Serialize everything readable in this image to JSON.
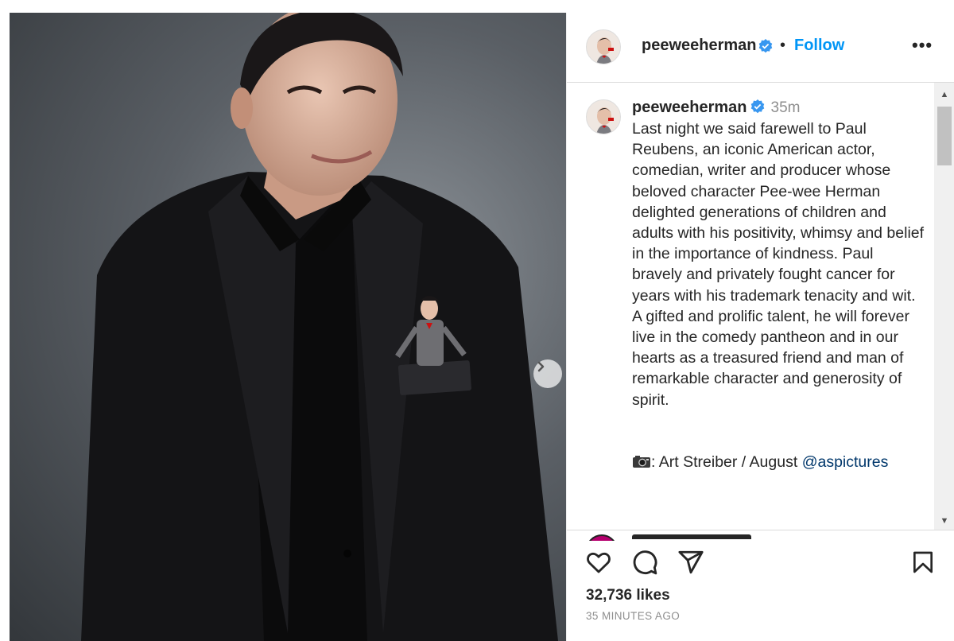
{
  "post": {
    "username": "peeweeherman",
    "follow_label": "Follow",
    "separator": "•",
    "more_label": "•••",
    "time": "35m",
    "caption": "Last night we said farewell to Paul Reubens, an iconic American actor, comedian, writer and producer whose beloved character Pee-wee Herman delighted generations of children and adults with his positivity, whimsy and belief in the importance of kindness. Paul bravely and privately fought cancer for years with his trademark tenacity and wit. A gifted and prolific talent, he will forever live in the comedy pantheon and in our hearts as a treasured friend and man of remarkable character and generosity of spirit.",
    "credit_text": ": Art Streiber / August ",
    "credit_mention": "@aspictures",
    "likes": "32,736 likes",
    "time_ago": "35 MINUTES AGO"
  },
  "icons": {
    "verified": "verified-badge-icon",
    "like": "heart-icon",
    "comment": "comment-bubble-icon",
    "share": "paper-plane-icon",
    "save": "bookmark-icon",
    "next": "chevron-right-icon",
    "camera": "camera-emoji-icon"
  },
  "colors": {
    "accent": "#0095f6",
    "mention": "#00376b",
    "verified": "#3897f0",
    "muted": "#8e8e8e"
  }
}
